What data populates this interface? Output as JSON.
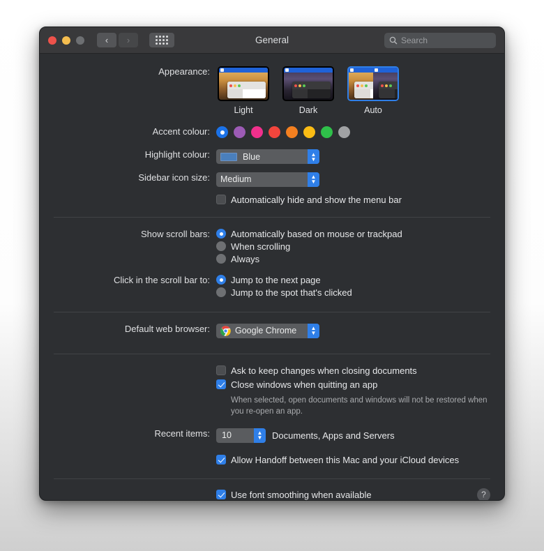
{
  "window": {
    "title": "General",
    "traffic_lights": [
      "close",
      "minimize",
      "zoom"
    ],
    "back_label": "‹",
    "forward_label": "›",
    "grid_label": "show-all-grid"
  },
  "search": {
    "placeholder": "Search",
    "value": "",
    "icon": "search-icon"
  },
  "appearance": {
    "label": "Appearance:",
    "options": [
      {
        "label": "Light",
        "selected": false
      },
      {
        "label": "Dark",
        "selected": false
      },
      {
        "label": "Auto",
        "selected": true
      }
    ]
  },
  "accent": {
    "label": "Accent colour:",
    "selected_index": 0,
    "swatches": [
      {
        "name": "blue",
        "color": "#1b72e8",
        "selected": true
      },
      {
        "name": "purple",
        "color": "#9c5bb5",
        "selected": false
      },
      {
        "name": "pink",
        "color": "#f0308c",
        "selected": false
      },
      {
        "name": "red",
        "color": "#f2453d",
        "selected": false
      },
      {
        "name": "orange",
        "color": "#f48020",
        "selected": false
      },
      {
        "name": "yellow",
        "color": "#fbbc14",
        "selected": false
      },
      {
        "name": "green",
        "color": "#2fc04a",
        "selected": false
      },
      {
        "name": "graphite",
        "color": "#a0a2a4",
        "selected": false
      }
    ]
  },
  "highlight": {
    "label": "Highlight colour:",
    "value": "Blue",
    "swatch_color": "#4a7fbc"
  },
  "sidebar_icon_size": {
    "label": "Sidebar icon size:",
    "value": "Medium"
  },
  "menubar_autohide": {
    "label": "Automatically hide and show the menu bar",
    "checked": false
  },
  "scroll_bars": {
    "label": "Show scroll bars:",
    "options": [
      {
        "label": "Automatically based on mouse or trackpad",
        "selected": true
      },
      {
        "label": "When scrolling",
        "selected": false
      },
      {
        "label": "Always",
        "selected": false
      }
    ]
  },
  "click_scroll_bar": {
    "label": "Click in the scroll bar to:",
    "options": [
      {
        "label": "Jump to the next page",
        "selected": true
      },
      {
        "label": "Jump to the spot that's clicked",
        "selected": false
      }
    ]
  },
  "default_browser": {
    "label": "Default web browser:",
    "value": "Google Chrome",
    "icon": "chrome-icon"
  },
  "documents": {
    "ask_keep_changes": {
      "label": "Ask to keep changes when closing documents",
      "checked": false
    },
    "close_windows": {
      "label": "Close windows when quitting an app",
      "checked": true
    },
    "help_text": "When selected, open documents and windows will not be restored when you re-open an app."
  },
  "recent_items": {
    "label": "Recent items:",
    "value": "10",
    "trailing": "Documents, Apps and Servers"
  },
  "handoff": {
    "label": "Allow Handoff between this Mac and your iCloud devices",
    "checked": true
  },
  "font_smoothing": {
    "label": "Use font smoothing when available",
    "checked": true
  },
  "help_button": {
    "label": "?"
  },
  "colors": {
    "accent_blue": "#2f7fe8",
    "window_bg": "#2d2f32",
    "titlebar_bg": "#39393b"
  }
}
